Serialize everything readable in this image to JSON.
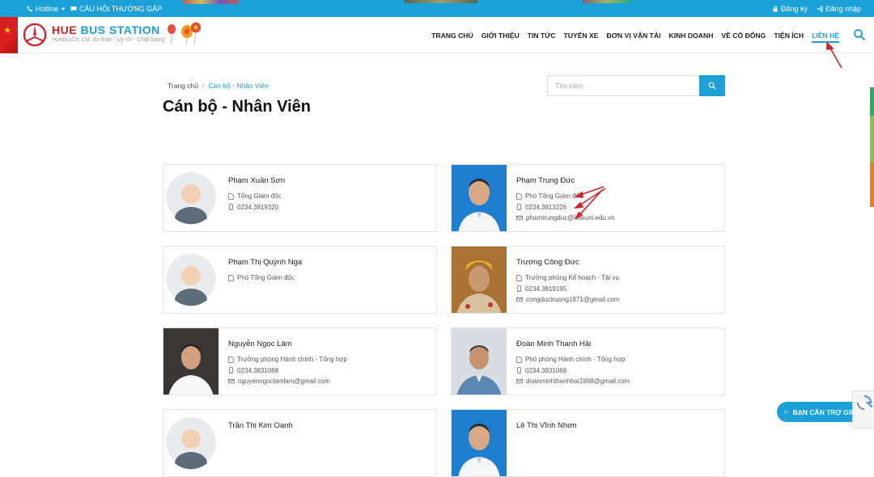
{
  "topbar": {
    "hotline_label": "Hotline",
    "faq_label": "CÂU HỎI THƯỜNG GẶP",
    "register_label": "Đăng ký",
    "login_label": "Đăng nhập"
  },
  "header": {
    "logo_hue": "HUE",
    "logo_bus_station": "BUS STATION",
    "slogan": "HuebusCo, Ltd. An toàn - Uy tín - Chất lượng",
    "nav": [
      {
        "label": "TRANG CHỦ",
        "active": false
      },
      {
        "label": "GIỚI THIỆU",
        "active": false
      },
      {
        "label": "TIN TỨC",
        "active": false
      },
      {
        "label": "TUYẾN XE",
        "active": false
      },
      {
        "label": "ĐƠN VỊ VẬN TẢI",
        "active": false
      },
      {
        "label": "KINH DOANH",
        "active": false
      },
      {
        "label": "VỀ CỔ ĐÔNG",
        "active": false
      },
      {
        "label": "TIỆN ÍCH",
        "active": false
      },
      {
        "label": "LIÊN HỆ",
        "active": true
      }
    ]
  },
  "breadcrumb": {
    "home": "Trang chủ",
    "separator": "/",
    "current": "Cán bộ - Nhân Viên"
  },
  "page_title": "Cán bộ - Nhân Viên",
  "search": {
    "placeholder": "Tìm kiếm"
  },
  "staff": [
    {
      "name": "Phạm Xuân Sơn",
      "position": "Tổng Giám đốc",
      "phone": "0234.3819320",
      "email": "",
      "photo": "avatar-placeholder"
    },
    {
      "name": "Phạm Trung Đức",
      "position": "Phó Tổng Giám đốc",
      "phone": "0234.3813226",
      "email": "phamtrungduc@hueuni.edu.vn",
      "photo": "portrait-blue-bg"
    },
    {
      "name": "Phạm Thị Quỳnh Nga",
      "position": "Phó Tổng Giám đốc",
      "phone": "",
      "email": "",
      "photo": "avatar-placeholder"
    },
    {
      "name": "Trương Công Đức",
      "position": "Trưởng phòng Kế hoạch - Tài vụ",
      "phone": "0234.3819195",
      "email": "congductruong1971@gmail.com",
      "photo": "portrait-traditional"
    },
    {
      "name": "Nguyễn Ngọc Lâm",
      "position": "Trưởng phòng Hành chính - Tổng hợp",
      "phone": "0234.3831068",
      "email": "nguyenngoclamlam@gmail.com",
      "photo": "portrait-dark-bg"
    },
    {
      "name": "Đoàn Minh Thanh Hải",
      "position": "Phó phòng Hành chính - Tổng hợp",
      "phone": "0234.3831068",
      "email": "doanminhthanhhai1988@gmail.com",
      "photo": "portrait-light-bg"
    },
    {
      "name": "Trần Thị Kim Oanh",
      "position": "",
      "phone": "",
      "email": "",
      "photo": "avatar-placeholder"
    },
    {
      "name": "Lê Thị Vĩnh Nhơn",
      "position": "",
      "phone": "",
      "email": "",
      "photo": "portrait-blue-bg"
    }
  ],
  "help_button_label": "BẠN CẦN TRỢ GIÚP?",
  "colors": {
    "accent": "#1ba0d8",
    "logo_red": "#d42027",
    "annotation_red": "#d42027"
  }
}
